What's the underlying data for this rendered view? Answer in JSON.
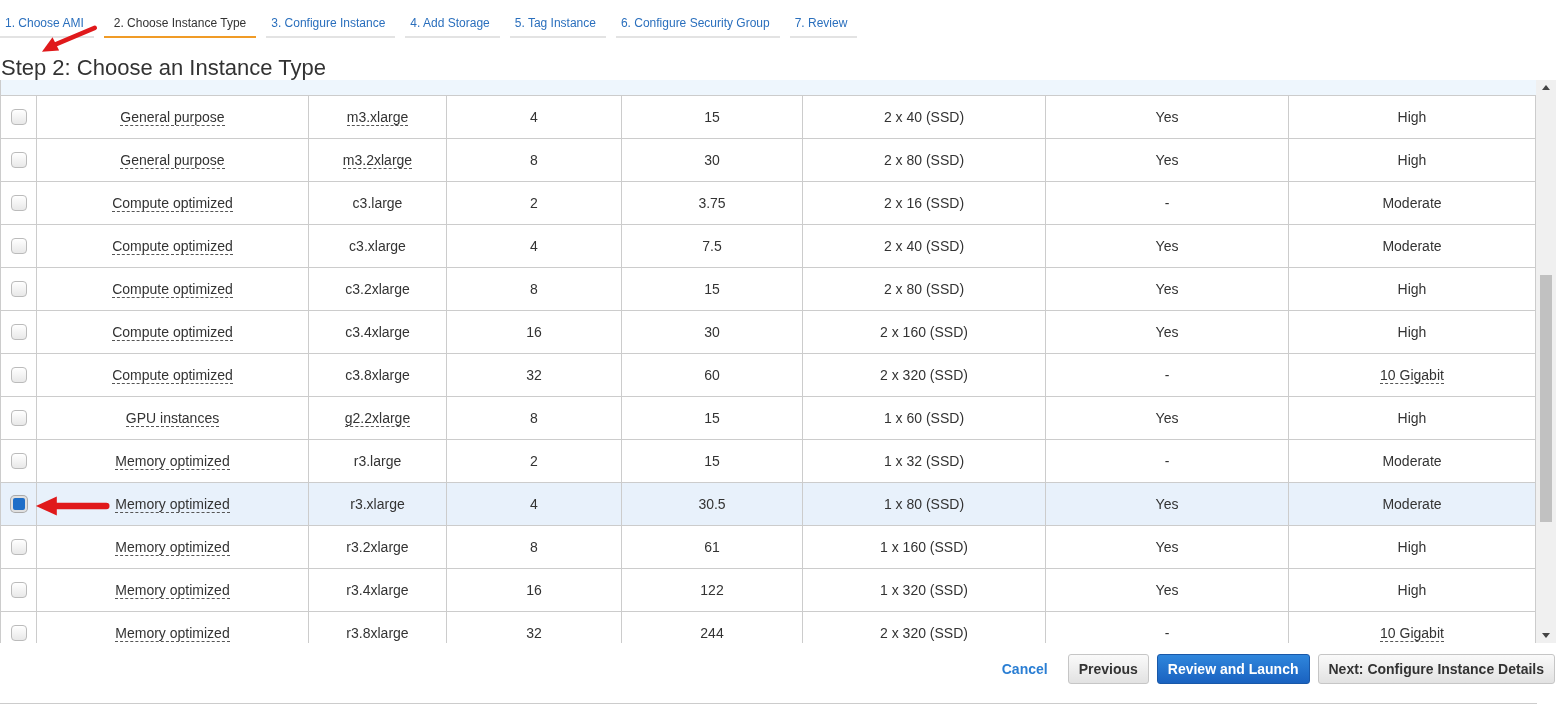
{
  "steps": [
    {
      "label": "1. Choose AMI",
      "selected": false
    },
    {
      "label": "2. Choose Instance Type",
      "selected": true
    },
    {
      "label": "3. Configure Instance",
      "selected": false
    },
    {
      "label": "4. Add Storage",
      "selected": false
    },
    {
      "label": "5. Tag Instance",
      "selected": false
    },
    {
      "label": "6. Configure Security Group",
      "selected": false
    },
    {
      "label": "7. Review",
      "selected": false
    }
  ],
  "title": "Step 2: Choose an Instance Type",
  "rows": [
    {
      "selected": false,
      "family": "General purpose",
      "type": "m3.xlarge",
      "type_hint": true,
      "vcpus": "4",
      "memory": "15",
      "storage": "2 x 40 (SSD)",
      "ebs_optimized": "Yes",
      "network": "High",
      "network_hint": false
    },
    {
      "selected": false,
      "family": "General purpose",
      "type": "m3.2xlarge",
      "type_hint": true,
      "vcpus": "8",
      "memory": "30",
      "storage": "2 x 80 (SSD)",
      "ebs_optimized": "Yes",
      "network": "High",
      "network_hint": false
    },
    {
      "selected": false,
      "family": "Compute optimized",
      "type": "c3.large",
      "type_hint": false,
      "vcpus": "2",
      "memory": "3.75",
      "storage": "2 x 16 (SSD)",
      "ebs_optimized": "-",
      "network": "Moderate",
      "network_hint": false
    },
    {
      "selected": false,
      "family": "Compute optimized",
      "type": "c3.xlarge",
      "type_hint": false,
      "vcpus": "4",
      "memory": "7.5",
      "storage": "2 x 40 (SSD)",
      "ebs_optimized": "Yes",
      "network": "Moderate",
      "network_hint": false
    },
    {
      "selected": false,
      "family": "Compute optimized",
      "type": "c3.2xlarge",
      "type_hint": false,
      "vcpus": "8",
      "memory": "15",
      "storage": "2 x 80 (SSD)",
      "ebs_optimized": "Yes",
      "network": "High",
      "network_hint": false
    },
    {
      "selected": false,
      "family": "Compute optimized",
      "type": "c3.4xlarge",
      "type_hint": false,
      "vcpus": "16",
      "memory": "30",
      "storage": "2 x 160 (SSD)",
      "ebs_optimized": "Yes",
      "network": "High",
      "network_hint": false
    },
    {
      "selected": false,
      "family": "Compute optimized",
      "type": "c3.8xlarge",
      "type_hint": false,
      "vcpus": "32",
      "memory": "60",
      "storage": "2 x 320 (SSD)",
      "ebs_optimized": "-",
      "network": "10 Gigabit",
      "network_hint": true
    },
    {
      "selected": false,
      "family": "GPU instances",
      "type": "g2.2xlarge",
      "type_hint": true,
      "vcpus": "8",
      "memory": "15",
      "storage": "1 x 60 (SSD)",
      "ebs_optimized": "Yes",
      "network": "High",
      "network_hint": false
    },
    {
      "selected": false,
      "family": "Memory optimized",
      "type": "r3.large",
      "type_hint": false,
      "vcpus": "2",
      "memory": "15",
      "storage": "1 x 32 (SSD)",
      "ebs_optimized": "-",
      "network": "Moderate",
      "network_hint": false
    },
    {
      "selected": true,
      "family": "Memory optimized",
      "type": "r3.xlarge",
      "type_hint": false,
      "vcpus": "4",
      "memory": "30.5",
      "storage": "1 x 80 (SSD)",
      "ebs_optimized": "Yes",
      "network": "Moderate",
      "network_hint": false
    },
    {
      "selected": false,
      "family": "Memory optimized",
      "type": "r3.2xlarge",
      "type_hint": false,
      "vcpus": "8",
      "memory": "61",
      "storage": "1 x 160 (SSD)",
      "ebs_optimized": "Yes",
      "network": "High",
      "network_hint": false
    },
    {
      "selected": false,
      "family": "Memory optimized",
      "type": "r3.4xlarge",
      "type_hint": false,
      "vcpus": "16",
      "memory": "122",
      "storage": "1 x 320 (SSD)",
      "ebs_optimized": "Yes",
      "network": "High",
      "network_hint": false
    },
    {
      "selected": false,
      "family": "Memory optimized",
      "type": "r3.8xlarge",
      "type_hint": false,
      "vcpus": "32",
      "memory": "244",
      "storage": "2 x 320 (SSD)",
      "ebs_optimized": "-",
      "network": "10 Gigabit",
      "network_hint": true
    }
  ],
  "buttons": {
    "cancel": "Cancel",
    "previous": "Previous",
    "primary": "Review and Launch",
    "next": "Next: Configure Instance Details"
  }
}
